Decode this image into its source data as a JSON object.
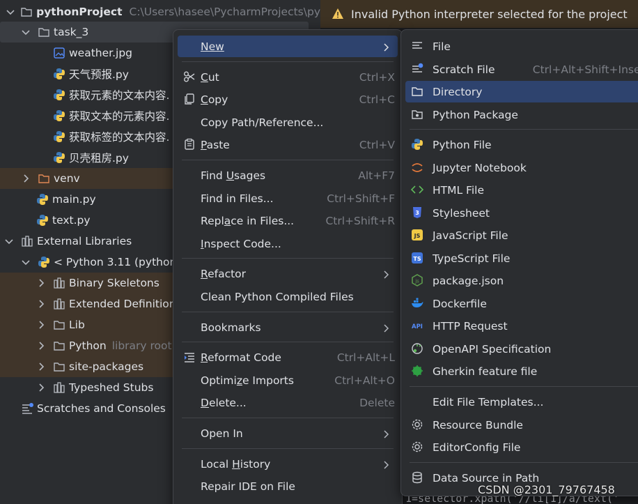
{
  "warning": {
    "text": "Invalid Python interpreter selected for the project"
  },
  "tree": {
    "root_name": "pythonProject",
    "root_path": "C:\\Users\\hasee\\PycharmProjects\\py",
    "task_folder": "task_3",
    "task_files": [
      "weather.jpg",
      "天气预报.py",
      "获取元素的文本内容.",
      "获取文本的元素内容.",
      "获取标签的文本内容.",
      "贝壳租房.py"
    ],
    "venv": "venv",
    "main": "main.py",
    "text": "text.py",
    "external_libraries": "External Libraries",
    "python_sdk": "< Python 3.11 (python",
    "sdk_children": [
      "Binary Skeletons",
      "Extended Definitior",
      "Lib",
      "Python",
      "site-packages",
      "Typeshed Stubs"
    ],
    "library_root_hint": "library root",
    "scratches": "Scratches and Consoles"
  },
  "menu1": {
    "new": "New",
    "cut": "Cut",
    "cut_sc": "Ctrl+X",
    "copy": "Copy",
    "copy_sc": "Ctrl+C",
    "copy_path": "Copy Path/Reference...",
    "paste": "Paste",
    "paste_sc": "Ctrl+V",
    "find_usages": "Find Usages",
    "find_usages_sc": "Alt+F7",
    "find_in_files": "Find in Files...",
    "find_in_files_sc": "Ctrl+Shift+F",
    "replace_in_files": "Replace in Files...",
    "replace_in_files_sc": "Ctrl+Shift+R",
    "inspect_code": "Inspect Code...",
    "refactor": "Refactor",
    "clean_compiled": "Clean Python Compiled Files",
    "bookmarks": "Bookmarks",
    "reformat": "Reformat Code",
    "reformat_sc": "Ctrl+Alt+L",
    "optimize": "Optimize Imports",
    "optimize_sc": "Ctrl+Alt+O",
    "delete": "Delete...",
    "delete_sc": "Delete",
    "open_in": "Open In",
    "local_history": "Local History",
    "repair_ide": "Repair IDE on File"
  },
  "menu2": {
    "file": "File",
    "scratch": "Scratch File",
    "scratch_sc": "Ctrl+Alt+Shift+Insert",
    "directory": "Directory",
    "python_package": "Python Package",
    "python_file": "Python File",
    "jupyter": "Jupyter Notebook",
    "html": "HTML File",
    "stylesheet": "Stylesheet",
    "javascript": "JavaScript File",
    "typescript": "TypeScript File",
    "package_json": "package.json",
    "dockerfile": "Dockerfile",
    "http": "HTTP Request",
    "openapi": "OpenAPI Specification",
    "gherkin": "Gherkin feature file",
    "edit_templates": "Edit File Templates...",
    "resource_bundle": "Resource Bundle",
    "editorconfig": "EditorConfig File",
    "datasource": "Data Source in Path"
  },
  "editor": {
    "code_fragment": "1=selector.xpath('//li[1]/a/text('"
  },
  "watermark": "CSDN @2301_79767458",
  "colors": {
    "accent": "#2e436e",
    "warning_bg": "#3d3223",
    "excluded_bg": "#40352a"
  }
}
